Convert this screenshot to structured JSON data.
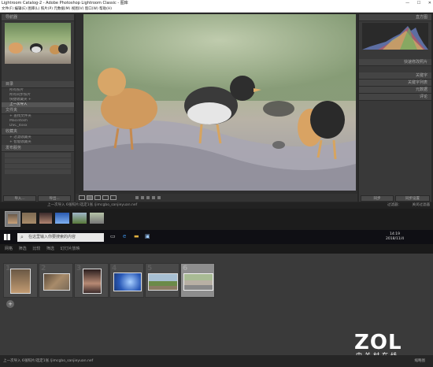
{
  "window": {
    "title": "Lightroom Catalog-2 - Adobe Photoshop Lightroom Classic - 图库",
    "minimize": "—",
    "maximize": "☐",
    "close": "✕"
  },
  "menubar": {
    "text": "文件(F)  编辑(E)  图库(L)  照片(P)  元数据(M)  视图(V)  窗口(W)  帮助(H)"
  },
  "left_panel": {
    "navigator_label": "导航器",
    "catalog_header": "目录",
    "catalog_items": [
      "所有照片",
      "所有同步照片",
      "快捷收藏夹 +",
      "上一次导入"
    ],
    "folders_header": "文件夹",
    "folders_items": [
      "+ 查找文件夹",
      "Macintosh",
      "DSC_4xxx"
    ],
    "collections_header": "收藏夹",
    "collections_items": [
      "+ 过滤收藏夹",
      "+ 智能收藏夹"
    ],
    "publish_header": "发布服务",
    "publish_items": [
      "",
      "",
      "",
      "",
      ""
    ],
    "import_button": "导入...",
    "export_button": "导出..."
  },
  "right_panel": {
    "histogram_label": "直方图",
    "rows": [
      "快速修改照片",
      "关键字",
      "关键字列表",
      "元数据",
      "评论"
    ],
    "sync_button": "同步",
    "sync_settings_button": "同步设置"
  },
  "filmstrip": {
    "label": "上一次导入  6张照片/选定1张 /jimcgbo_sanjieyuan.nef",
    "filter_label": "过滤器：",
    "filter_value": "关闭过滤器"
  },
  "taskbar": {
    "search_placeholder": "在这里输入你要搜索的内容",
    "time": "14:19",
    "date": "2018/11/4"
  },
  "bottom": {
    "tabs": [
      "网格",
      "筛选",
      "比较",
      "筛选",
      "幻灯片放映"
    ],
    "cells": [
      "1",
      "2",
      "3",
      "4",
      "5",
      "6"
    ]
  },
  "footer": {
    "text": "上一次导入  6张照片/选定1张 /jimcgbo_sanjieyuan.nef",
    "right": "缩略图"
  },
  "watermark": {
    "brand": "ZOL",
    "sub": "中关村在线"
  },
  "colors": {
    "panel": "#393939",
    "background": "#282828",
    "selected": "#8e8e8e"
  }
}
